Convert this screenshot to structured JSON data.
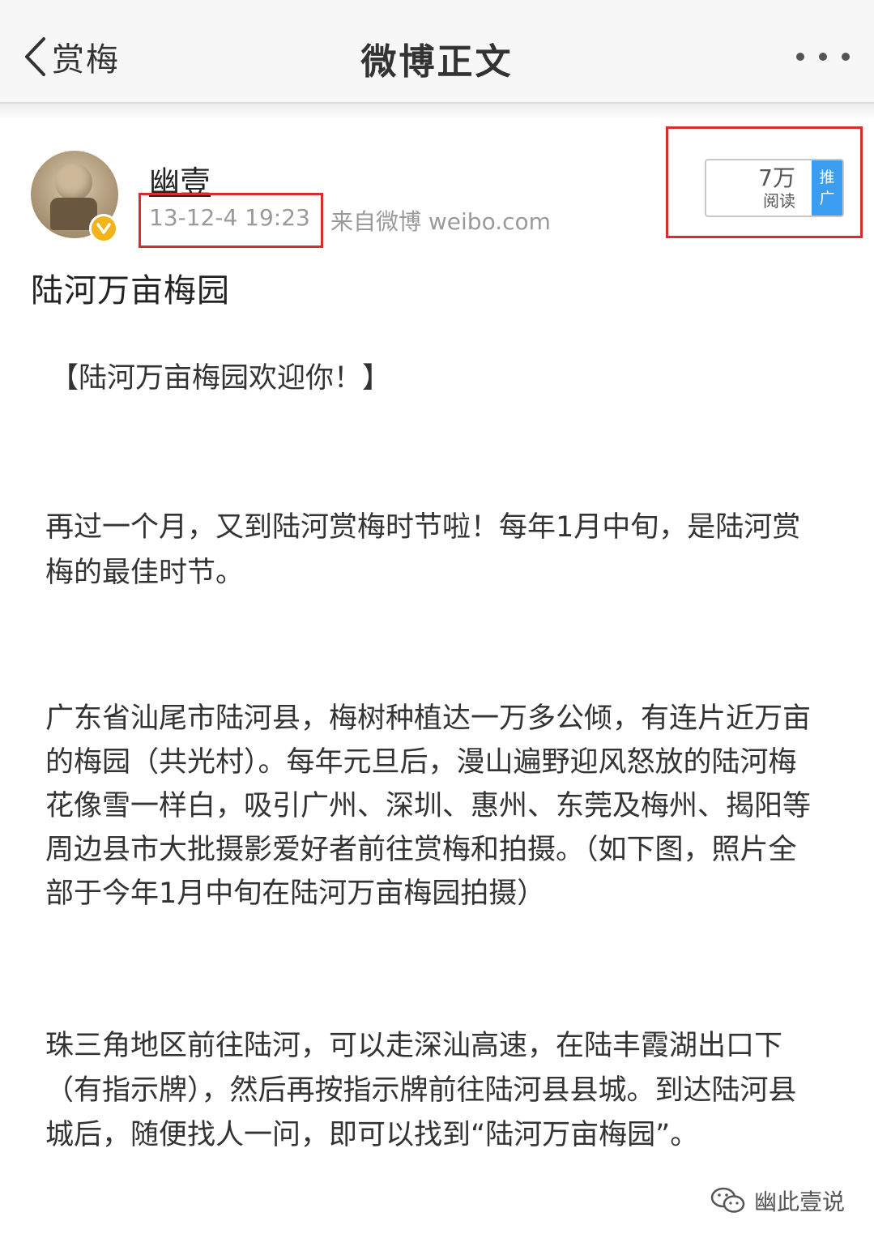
{
  "nav": {
    "back_label": "赏梅",
    "title": "微博正文",
    "back_icon": "chevron-left-icon",
    "more_icon": "more-dots-icon"
  },
  "post": {
    "username": "幽壹",
    "timestamp": "13-12-4 19:23",
    "source": "来自微博 weibo.com",
    "read_count": "7万",
    "read_label": "阅读",
    "promote_label_1": "推",
    "promote_label_2": "广",
    "title": "陆河万亩梅园",
    "heading": "【陆河万亩梅园欢迎你！】",
    "para1": "再过一个月，又到陆河赏梅时节啦！每年1月中旬，是陆河赏梅的最佳时节。",
    "para2": "广东省汕尾市陆河县，梅树种植达一万多公倾，有连片近万亩的梅园（共光村）。每年元旦后，漫山遍野迎风怒放的陆河梅花像雪一样白，吸引广州、深圳、惠州、东莞及梅州、揭阳等周边县市大批摄影爱好者前往赏梅和拍摄。（如下图，照片全部于今年1月中旬在陆河万亩梅园拍摄）",
    "para3": "珠三角地区前往陆河，可以走深汕高速，在陆丰霞湖出口下（有指示牌），然后再按指示牌前往陆河县县城。到达陆河县城后，随便找人一问，即可以找到“陆河万亩梅园”。"
  },
  "watermark": {
    "text": "幽此壹说",
    "icon": "wechat-icon"
  },
  "colors": {
    "highlight_box": "#d32f2f",
    "promote_blue": "#3a9df0",
    "verified_badge": "#f2b41c"
  }
}
